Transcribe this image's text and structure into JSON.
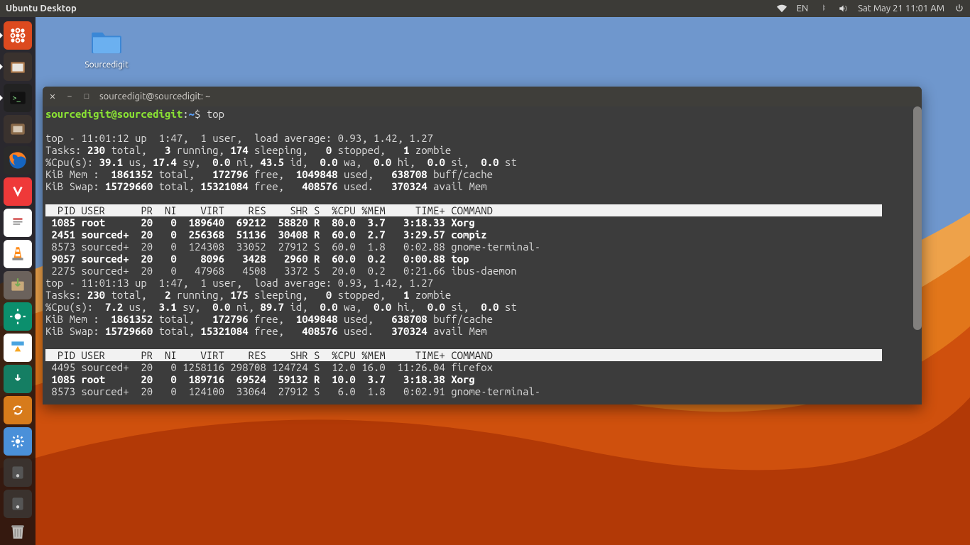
{
  "topbar": {
    "title": "Ubuntu Desktop",
    "lang": "EN",
    "datetime": "Sat May 21 11:01 AM"
  },
  "desktop_icon": {
    "label": "Sourcedigit"
  },
  "launcher": {
    "items": [
      {
        "name": "dash-icon",
        "bg": "#dc4a1f"
      },
      {
        "name": "files-icon",
        "bg": "#3a322e"
      },
      {
        "name": "terminal-icon",
        "bg": "#222"
      },
      {
        "name": "nautilus-icon",
        "bg": "#3a322e"
      },
      {
        "name": "firefox-icon",
        "bg": "#2b2b2b"
      },
      {
        "name": "vivaldi-icon",
        "bg": "#ef3939"
      },
      {
        "name": "editor-icon",
        "bg": "#fff"
      },
      {
        "name": "vlc-icon",
        "bg": "#fff"
      },
      {
        "name": "gdebi-icon",
        "bg": "#6b625c"
      },
      {
        "name": "screenshot-icon",
        "bg": "#0b8f6d"
      },
      {
        "name": "software-icon",
        "bg": "#fff"
      },
      {
        "name": "update-icon",
        "bg": "#157e63"
      },
      {
        "name": "sync-icon",
        "bg": "#d77b1b"
      },
      {
        "name": "settings-icon",
        "bg": "#4a90d9"
      },
      {
        "name": "device-icon",
        "bg": "#3a322e"
      },
      {
        "name": "device2-icon",
        "bg": "#3a322e"
      }
    ],
    "trash": "trash-icon"
  },
  "terminal": {
    "title": "sourcedigit@sourcedigit: ~",
    "prompt_user": "sourcedigit@sourcedigit",
    "prompt_path": "~",
    "prompt_sym": "$",
    "command": "top",
    "blocks": [
      {
        "uptime": "top - 11:01:12 up  1:47,  1 user,  load average: 0.93, 1.42, 1.27",
        "tasks": {
          "total": "230",
          "running": "3",
          "sleeping": "174",
          "stopped": "0",
          "zombie": "1"
        },
        "cpu": {
          "us": "39.1",
          "sy": "17.4",
          "ni": "0.0",
          "id": "43.5",
          "wa": "0.0",
          "hi": "0.0",
          "si": "0.0",
          "st": "0.0"
        },
        "mem": {
          "total": "1861352",
          "free": "172796",
          "used": "1049848",
          "buff": "638708"
        },
        "swap": {
          "total": "15729660",
          "free": "15321084",
          "used": "408576",
          "avail": "370324"
        },
        "header": "  PID USER      PR  NI    VIRT    RES    SHR S  %CPU %MEM     TIME+ COMMAND",
        "rows": [
          {
            "bold": true,
            "pid": "1085",
            "user": "root    ",
            "pr": "20",
            "ni": "0",
            "virt": "189640",
            "res": "69212",
            "shr": "58820",
            "s": "R",
            "cpu": "80.0",
            "mem": "3.7",
            "time": "3:18.33",
            "cmd": "Xorg"
          },
          {
            "bold": true,
            "pid": "2451",
            "user": "sourced+",
            "pr": "20",
            "ni": "0",
            "virt": "256368",
            "res": "51136",
            "shr": "30408",
            "s": "R",
            "cpu": "60.0",
            "mem": "2.7",
            "time": "3:29.57",
            "cmd": "compiz"
          },
          {
            "bold": false,
            "pid": "8573",
            "user": "sourced+",
            "pr": "20",
            "ni": "0",
            "virt": "124308",
            "res": "33052",
            "shr": "27912",
            "s": "S",
            "cpu": "60.0",
            "mem": "1.8",
            "time": "0:02.88",
            "cmd": "gnome-terminal-"
          },
          {
            "bold": true,
            "pid": "9057",
            "user": "sourced+",
            "pr": "20",
            "ni": "0",
            "virt": "8096",
            "res": "3428",
            "shr": "2960",
            "s": "R",
            "cpu": "60.0",
            "mem": "0.2",
            "time": "0:00.88",
            "cmd": "top"
          },
          {
            "bold": false,
            "pid": "2275",
            "user": "sourced+",
            "pr": "20",
            "ni": "0",
            "virt": "47968",
            "res": "4508",
            "shr": "3372",
            "s": "S",
            "cpu": "20.0",
            "mem": "0.2",
            "time": "0:21.66",
            "cmd": "ibus-daemon"
          }
        ]
      },
      {
        "uptime": "top - 11:01:13 up  1:47,  1 user,  load average: 0.93, 1.42, 1.27",
        "tasks": {
          "total": "230",
          "running": "2",
          "sleeping": "175",
          "stopped": "0",
          "zombie": "1"
        },
        "cpu": {
          "us": "7.2",
          "sy": "3.1",
          "ni": "0.0",
          "id": "89.7",
          "wa": "0.0",
          "hi": "0.0",
          "si": "0.0",
          "st": "0.0"
        },
        "mem": {
          "total": "1861352",
          "free": "172796",
          "used": "1049848",
          "buff": "638708"
        },
        "swap": {
          "total": "15729660",
          "free": "15321084",
          "used": "408576",
          "avail": "370324"
        },
        "header": "  PID USER      PR  NI    VIRT    RES    SHR S  %CPU %MEM     TIME+ COMMAND",
        "rows": [
          {
            "bold": false,
            "pid": "4495",
            "user": "sourced+",
            "pr": "20",
            "ni": "0",
            "virt": "1258116",
            "res": "298708",
            "shr": "124724",
            "s": "S",
            "cpu": "12.0",
            "mem": "16.0",
            "time": "11:26.04",
            "cmd": "firefox"
          },
          {
            "bold": true,
            "pid": "1085",
            "user": "root    ",
            "pr": "20",
            "ni": "0",
            "virt": "189716",
            "res": "69524",
            "shr": "59132",
            "s": "R",
            "cpu": "10.0",
            "mem": "3.7",
            "time": "3:18.38",
            "cmd": "Xorg"
          },
          {
            "bold": false,
            "pid": "8573",
            "user": "sourced+",
            "pr": "20",
            "ni": "0",
            "virt": "124100",
            "res": "33064",
            "shr": "27912",
            "s": "S",
            "cpu": "6.0",
            "mem": "1.8",
            "time": "0:02.91",
            "cmd": "gnome-terminal-"
          }
        ]
      }
    ]
  }
}
